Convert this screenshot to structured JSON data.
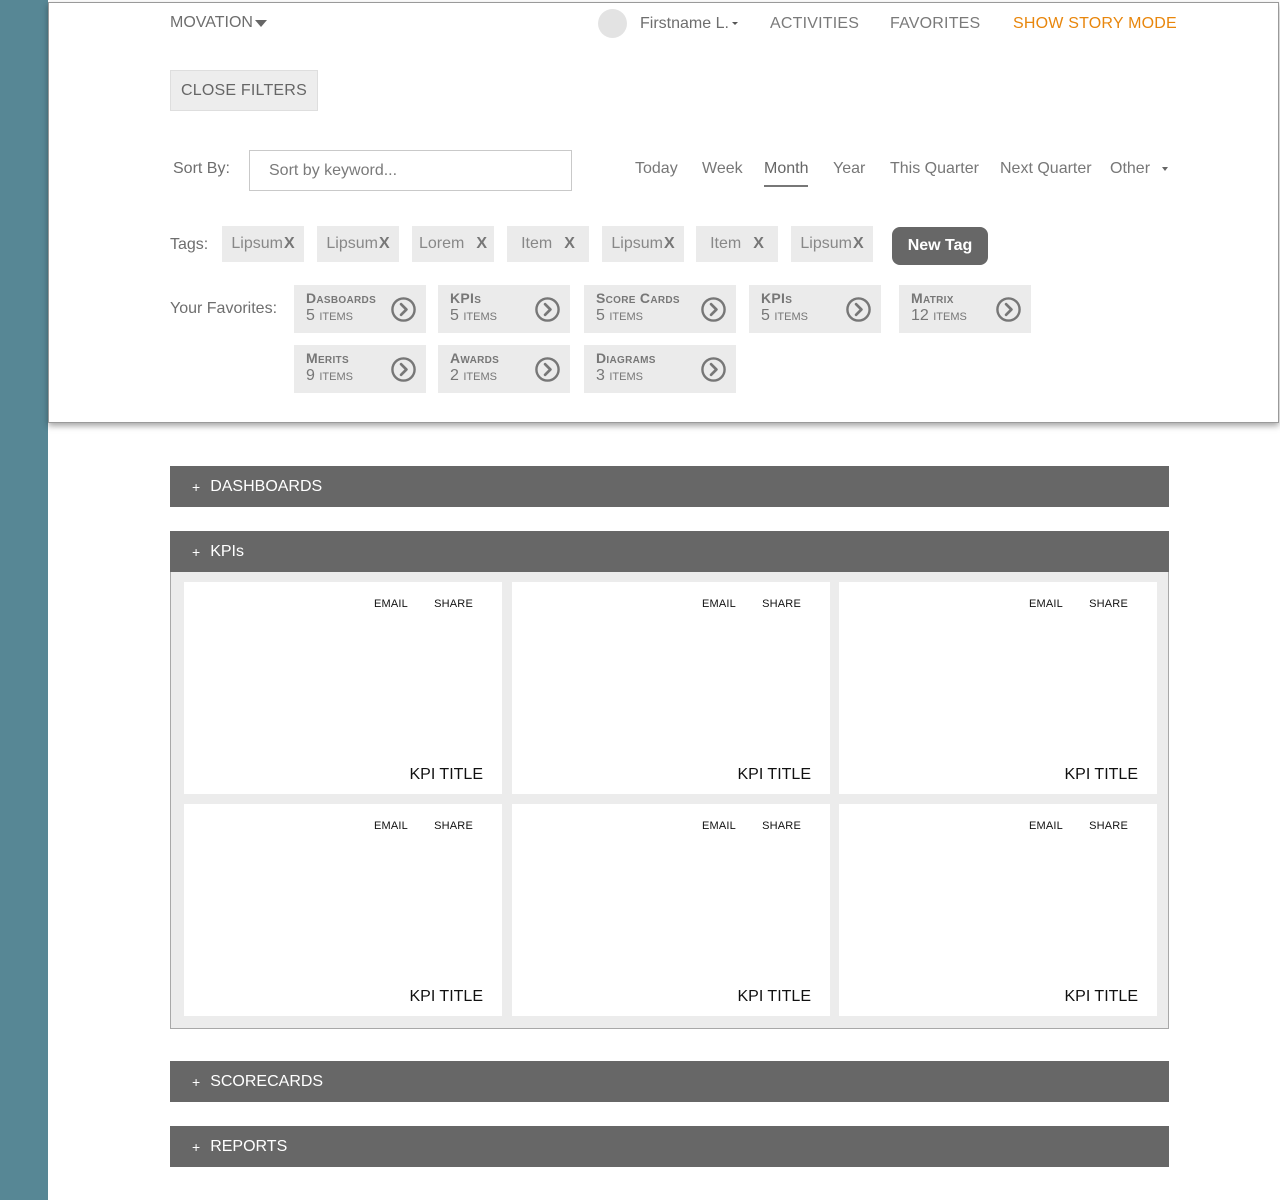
{
  "header": {
    "brand": "MOVATION",
    "user_name": "Firstname L.",
    "nav": {
      "activities": "ACTIVITIES",
      "favorites": "FAVORITES",
      "story_mode": "SHOW STORY MODE"
    }
  },
  "filters": {
    "close_label": "CLOSE FILTERS",
    "sort_label": "Sort By:",
    "sort_placeholder": "Sort by keyword...",
    "periods": [
      "Today",
      "Week",
      "Month",
      "Year",
      "This Quarter",
      "Next Quarter",
      "Other"
    ],
    "active_period": "Month",
    "tags_label": "Tags:",
    "tags": [
      {
        "label": "Lipsum",
        "remove": "X"
      },
      {
        "label": "Lipsum",
        "remove": "X"
      },
      {
        "label": "Lorem",
        "remove": "X"
      },
      {
        "label": "Item",
        "remove": "X"
      },
      {
        "label": "Lipsum",
        "remove": "X"
      },
      {
        "label": "Item",
        "remove": "X"
      },
      {
        "label": "Lipsum",
        "remove": "X"
      }
    ],
    "new_tag_label": "New Tag",
    "favorites_label": "Your Favorites:",
    "favorites": [
      {
        "title": "Dasboards",
        "count": "5 items"
      },
      {
        "title": "KPIs",
        "count": "5 items"
      },
      {
        "title": "Score Cards",
        "count": "5 items"
      },
      {
        "title": "KPIs",
        "count": "5 items"
      },
      {
        "title": "Matrix",
        "count": "12 items"
      },
      {
        "title": "Merits",
        "count": "9 items"
      },
      {
        "title": "Awards",
        "count": "2 items"
      },
      {
        "title": "Diagrams",
        "count": "3 items"
      }
    ]
  },
  "sections": {
    "plus": "+",
    "dashboards": "DASHBOARDS",
    "kpis": "KPIs",
    "scorecards": "SCORECARDS",
    "reports": "REPORTS"
  },
  "kpi_cards": [
    {
      "email": "EMAIL",
      "share": "SHARE",
      "title": "KPI TITLE"
    },
    {
      "email": "EMAIL",
      "share": "SHARE",
      "title": "KPI TITLE"
    },
    {
      "email": "EMAIL",
      "share": "SHARE",
      "title": "KPI TITLE"
    },
    {
      "email": "EMAIL",
      "share": "SHARE",
      "title": "KPI TITLE"
    },
    {
      "email": "EMAIL",
      "share": "SHARE",
      "title": "KPI TITLE"
    },
    {
      "email": "EMAIL",
      "share": "SHARE",
      "title": "KPI TITLE"
    }
  ],
  "colors": {
    "side_strip": "#578795",
    "accent_orange": "#e8860c",
    "section_bar": "#676767"
  }
}
